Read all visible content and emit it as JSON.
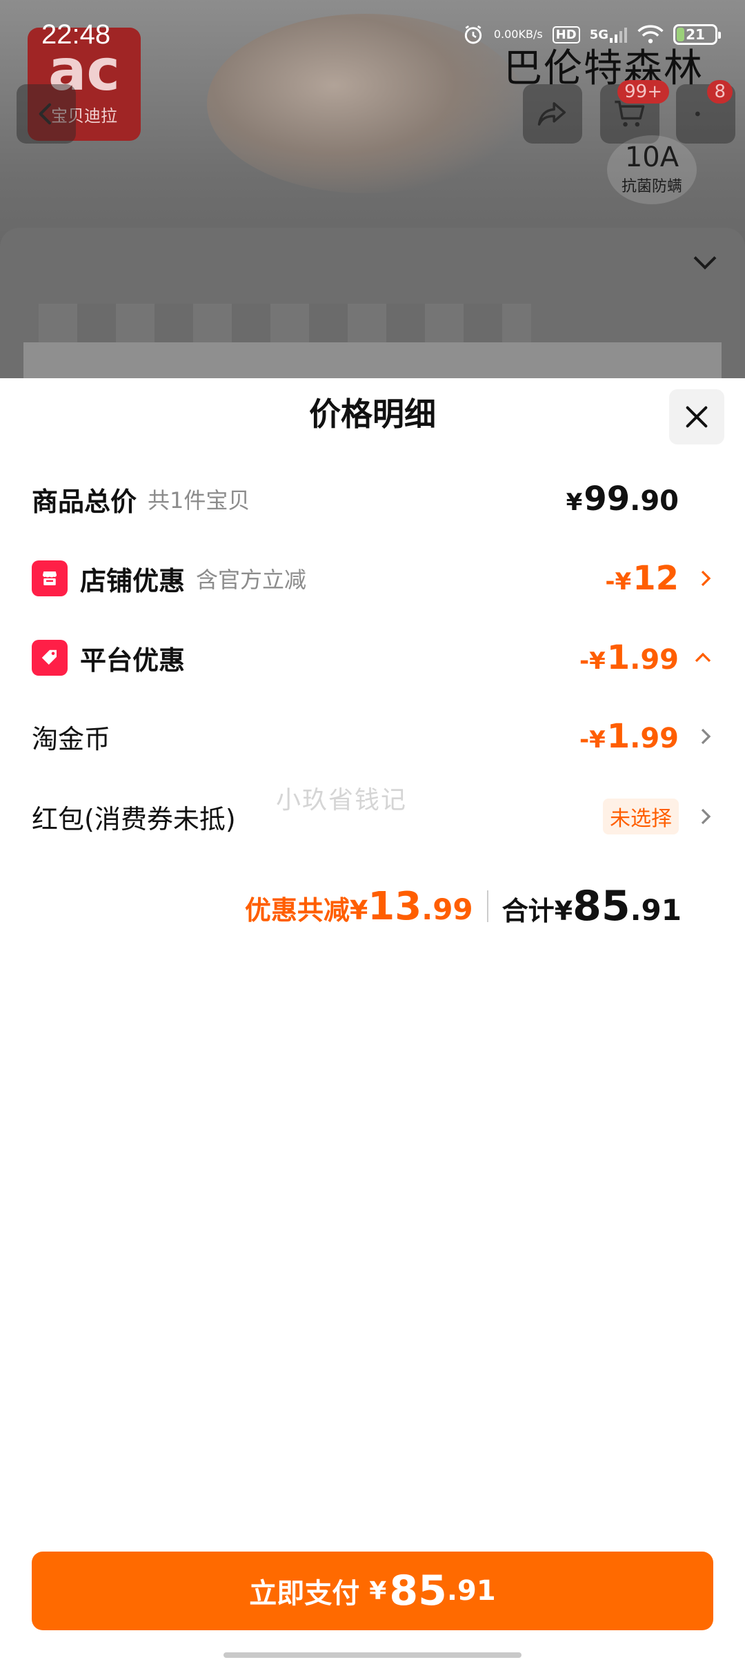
{
  "status_bar": {
    "time": "22:48",
    "net_speed_value": "0.00",
    "net_speed_unit": "KB/s",
    "hd_label": "HD",
    "network": "5G",
    "battery_level": "21",
    "battery_fraction": 0.21
  },
  "background": {
    "logo_mark": "ac",
    "logo_brand": "宝贝迪拉",
    "brand_right": "巴伦特森林",
    "cart_badge": "99+",
    "more_badge": "8",
    "tag_big": "10A",
    "tag_small": "抗菌防螨"
  },
  "sheet": {
    "title": "价格明细",
    "rows": [
      {
        "label": "商品总价",
        "sub": "共1件宝贝",
        "amount_prefix": "¥",
        "amount_int": "99",
        "amount_dec": ".90"
      },
      {
        "label": "店铺优惠",
        "sub": "含官方立减",
        "amount_prefix": "-¥",
        "amount_int": "12",
        "amount_dec": ""
      },
      {
        "label": "平台优惠",
        "sub": "",
        "amount_prefix": "-¥",
        "amount_int": "1",
        "amount_dec": ".99"
      },
      {
        "label": "淘金币",
        "sub": "",
        "amount_prefix": "-¥",
        "amount_int": "1",
        "amount_dec": ".99"
      },
      {
        "label": "红包(消费券未抵)",
        "pill": "未选择"
      }
    ],
    "watermark": "小玖省钱记",
    "summary": {
      "discount_label": "优惠共减¥",
      "discount_int": "13",
      "discount_dec": ".99",
      "total_label": "合计¥",
      "total_int": "85",
      "total_dec": ".91"
    }
  },
  "pay_button": {
    "label": "立即支付",
    "yen": "¥",
    "int": "85",
    "dec": ".91"
  },
  "colors": {
    "accent_orange": "#ff5e00",
    "pay_button": "#ff6a00",
    "icon_red": "#ff1f47"
  }
}
